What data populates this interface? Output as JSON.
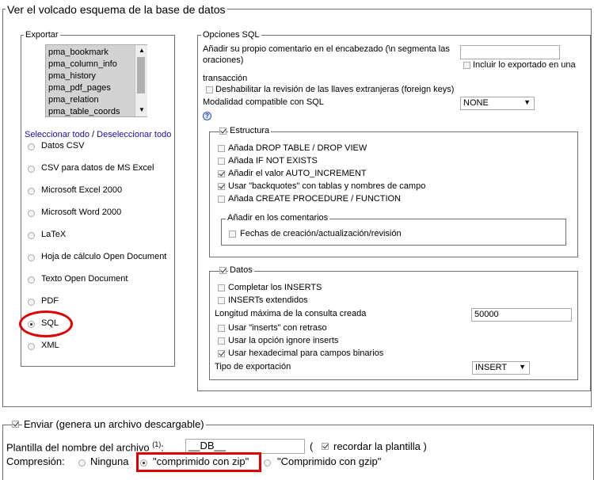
{
  "main_legend": "Ver el volcado esquema de la base de datos",
  "exportar": {
    "legend": "Exportar",
    "tables": [
      "pma_bookmark",
      "pma_column_info",
      "pma_history",
      "pma_pdf_pages",
      "pma_relation",
      "pma_table_coords"
    ],
    "select_all": "Seleccionar todo",
    "separator": "/",
    "deselect_all": "Deseleccionar todo",
    "formats": [
      "Datos CSV",
      "CSV para datos de MS Excel",
      "Microsoft Excel 2000",
      "Microsoft Word 2000",
      "LaTeX",
      "Hoja de cálculo Open Document",
      "Texto Open Document",
      "PDF",
      "SQL",
      "XML"
    ],
    "selected_format": "SQL"
  },
  "sql_options": {
    "legend": "Opciones SQL",
    "comment_label_1": "Añadir su propio comentario en el encabezado (\\n segmenta las",
    "comment_label_2": "oraciones)",
    "comment_value": "",
    "include_exported_in": "Incluir lo exportado en una",
    "transaction": "transacción",
    "disable_fk": "Deshabilitar la revisión de las llaves extranjeras (foreign keys)",
    "compat_label": "Modalidad compatible con SQL",
    "compat_value": "NONE",
    "help_icon_label": "?"
  },
  "estructura": {
    "legend": "Estructura",
    "options": [
      {
        "label": "Añada DROP TABLE / DROP VIEW",
        "checked": false
      },
      {
        "label": "Añada IF NOT EXISTS",
        "checked": false
      },
      {
        "label": "Añadir el valor AUTO_INCREMENT",
        "checked": true
      },
      {
        "label": "Usar \"backquotes\" con tablas y nombres de campo",
        "checked": true
      },
      {
        "label": "Añada CREATE PROCEDURE / FUNCTION",
        "checked": false
      }
    ],
    "comments_legend": "Añadir en los comentarios",
    "comments_option": "Fechas de creación/actualización/revisión"
  },
  "datos": {
    "legend": "Datos",
    "complete_inserts": "Completar los INSERTS",
    "extended_inserts": "INSERTs extendidos",
    "max_query_label": "Longitud máxima de la consulta creada",
    "max_query_value": "50000",
    "delayed_inserts": "Usar \"inserts\" con retraso",
    "ignore_option": "Usar la opción ignore inserts",
    "hex_binary": "Usar hexadecimal para campos binarios",
    "export_type_label": "Tipo de exportación",
    "export_type_value": "INSERT"
  },
  "send": {
    "legend": "Enviar (genera un archivo descargable)",
    "template_label": "Plantilla del nombre del archivo",
    "template_sup": "(1)",
    "template_colon": ":",
    "template_value": "__DB__",
    "paren_open": "(",
    "remember_label": "recordar la plantilla )",
    "compression_label": "Compresión:",
    "none_label": "Ninguna",
    "zip_label": "\"comprimido con zip\"",
    "gzip_label": "\"Comprimido con gzip\"",
    "selected_compression": "zip"
  },
  "colors": {
    "annotation": "#e00000",
    "link": "#1a0dab",
    "border": "#6f6f6f"
  }
}
